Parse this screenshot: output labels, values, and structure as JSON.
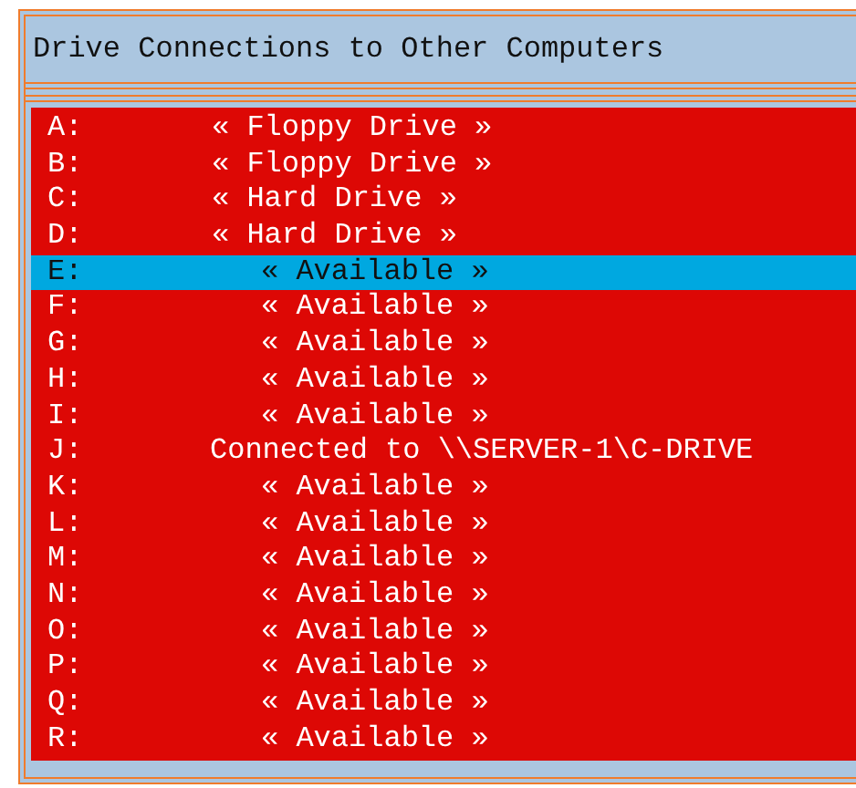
{
  "window": {
    "title": "Drive Connections to Other Computers"
  },
  "drives": [
    {
      "letter": "A:",
      "description": "« Floppy Drive »",
      "kind": "local",
      "selected": false
    },
    {
      "letter": "B:",
      "description": "« Floppy Drive »",
      "kind": "local",
      "selected": false
    },
    {
      "letter": "C:",
      "description": "« Hard Drive »",
      "kind": "local",
      "selected": false
    },
    {
      "letter": "D:",
      "description": "« Hard Drive »",
      "kind": "local",
      "selected": false
    },
    {
      "letter": "E:",
      "description": "« Available »",
      "kind": "available",
      "selected": true
    },
    {
      "letter": "F:",
      "description": "« Available »",
      "kind": "available",
      "selected": false
    },
    {
      "letter": "G:",
      "description": "« Available »",
      "kind": "available",
      "selected": false
    },
    {
      "letter": "H:",
      "description": "« Available »",
      "kind": "available",
      "selected": false
    },
    {
      "letter": "I:",
      "description": "« Available »",
      "kind": "available",
      "selected": false
    },
    {
      "letter": "J:",
      "description": "Connected to \\\\SERVER-1\\C-DRIVE",
      "kind": "connected",
      "selected": false
    },
    {
      "letter": "K:",
      "description": "« Available »",
      "kind": "available",
      "selected": false
    },
    {
      "letter": "L:",
      "description": "« Available »",
      "kind": "available",
      "selected": false
    },
    {
      "letter": "M:",
      "description": "« Available »",
      "kind": "available",
      "selected": false
    },
    {
      "letter": "N:",
      "description": "« Available »",
      "kind": "available",
      "selected": false
    },
    {
      "letter": "O:",
      "description": "« Available »",
      "kind": "available",
      "selected": false
    },
    {
      "letter": "P:",
      "description": "« Available »",
      "kind": "available",
      "selected": false
    },
    {
      "letter": "Q:",
      "description": "« Available »",
      "kind": "available",
      "selected": false
    },
    {
      "letter": "R:",
      "description": "« Available »",
      "kind": "available",
      "selected": false
    }
  ]
}
